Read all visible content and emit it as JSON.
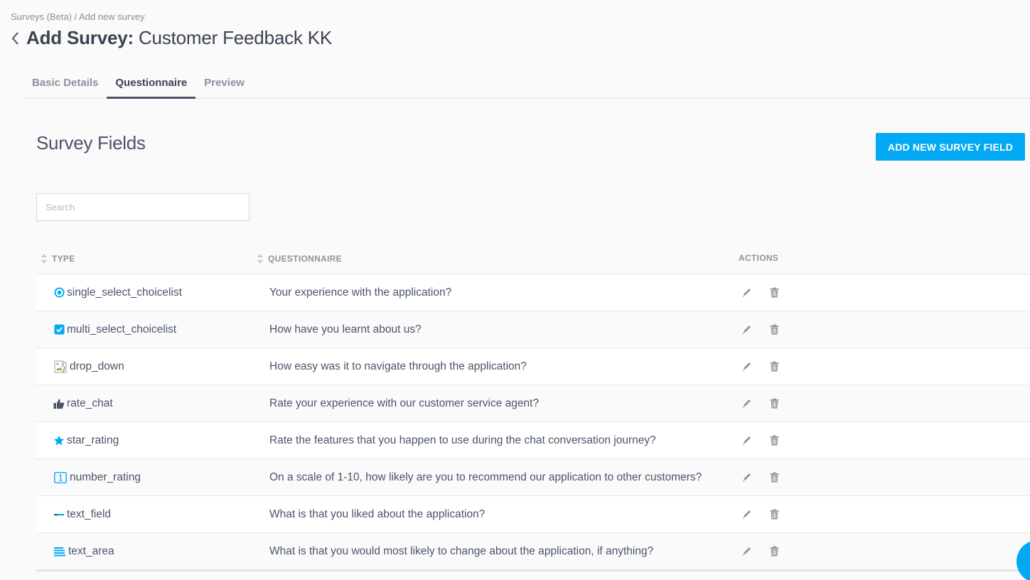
{
  "breadcrumb": "Surveys (Beta) / Add new survey",
  "title": {
    "prefix": "Add Survey:",
    "name": "Customer Feedback KK"
  },
  "tabs": [
    {
      "label": "Basic Details",
      "active": false
    },
    {
      "label": "Questionnaire",
      "active": true
    },
    {
      "label": "Preview",
      "active": false
    }
  ],
  "section_title": "Survey Fields",
  "add_button_label": "ADD NEW SURVEY FIELD",
  "search": {
    "placeholder": "Search",
    "value": ""
  },
  "columns": {
    "type": "TYPE",
    "questionnaire": "QUESTIONNAIRE",
    "actions": "ACTIONS"
  },
  "rows": [
    {
      "type": "single_select_choicelist",
      "icon": "radio-icon",
      "question": "Your experience with the application?"
    },
    {
      "type": "multi_select_choicelist",
      "icon": "checkbox-icon",
      "question": "How have you learnt about us?"
    },
    {
      "type": "drop_down",
      "icon": "broken-image-icon",
      "question": "How easy was it to navigate through the application?"
    },
    {
      "type": "rate_chat",
      "icon": "thumbs-up-icon",
      "question": "Rate your experience with our customer service agent?"
    },
    {
      "type": "star_rating",
      "icon": "star-icon",
      "question": "Rate the features that you happen to use during the chat conversation journey?"
    },
    {
      "type": "number_rating",
      "icon": "number-icon",
      "question": "On a scale of 1-10, how likely are you to recommend our application to other customers?"
    },
    {
      "type": "text_field",
      "icon": "text-field-icon",
      "question": "What is that you liked about the application?"
    },
    {
      "type": "text_area",
      "icon": "text-area-icon",
      "question": "What is that you would most likely to change about the application, if anything?"
    }
  ],
  "colors": {
    "accent": "#03a9f4",
    "text": "#4a5568",
    "muted": "#8e939c"
  }
}
